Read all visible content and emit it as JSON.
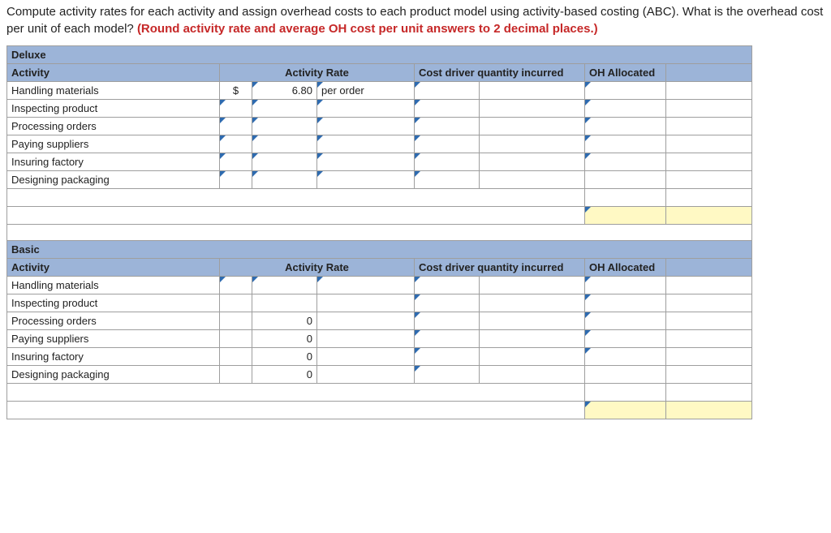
{
  "question": {
    "text1": "Compute activity rates for each activity and assign overhead costs to each product model using activity-based costing (ABC). What is the overhead cost per unit of each model? ",
    "red": "(Round activity rate and average OH cost per unit answers to 2 decimal places.)"
  },
  "headers": {
    "activity": "Activity",
    "activity_rate": "Activity Rate",
    "cost_driver": "Cost driver quantity incurred",
    "oh_allocated": "OH Allocated"
  },
  "sections": [
    {
      "title": "Deluxe",
      "rows": [
        {
          "activity": "Handling materials",
          "rate_sym": "$",
          "rate_val": "6.80",
          "rate_unit": "per order",
          "corner_r1": false,
          "corner_r2": true,
          "cdq_corner": true,
          "oh_corner": true
        },
        {
          "activity": "Inspecting product",
          "rate_sym": "",
          "rate_val": "",
          "rate_unit": "",
          "corner_r1": true,
          "corner_r2": true,
          "cdq_corner": true,
          "oh_corner": true
        },
        {
          "activity": "Processing orders",
          "rate_sym": "",
          "rate_val": "",
          "rate_unit": "",
          "corner_r1": true,
          "corner_r2": true,
          "cdq_corner": true,
          "oh_corner": true
        },
        {
          "activity": "Paying suppliers",
          "rate_sym": "",
          "rate_val": "",
          "rate_unit": "",
          "corner_r1": true,
          "corner_r2": true,
          "cdq_corner": true,
          "oh_corner": true
        },
        {
          "activity": "Insuring factory",
          "rate_sym": "",
          "rate_val": "",
          "rate_unit": "",
          "corner_r1": true,
          "corner_r2": true,
          "cdq_corner": true,
          "oh_corner": true
        },
        {
          "activity": "Designing packaging",
          "rate_sym": "",
          "rate_val": "",
          "rate_unit": "",
          "corner_r1": true,
          "corner_r2": true,
          "cdq_corner": true,
          "oh_corner": false
        }
      ],
      "footer_corner": true
    },
    {
      "title": "Basic",
      "rows": [
        {
          "activity": "Handling materials",
          "rate_sym": "",
          "rate_val": "",
          "rate_unit": "",
          "corner_r1": true,
          "corner_r2": true,
          "cdq_corner": true,
          "oh_corner": true
        },
        {
          "activity": "Inspecting product",
          "rate_sym": "",
          "rate_val": "",
          "rate_unit": "",
          "corner_r1": false,
          "corner_r2": false,
          "cdq_corner": true,
          "oh_corner": true
        },
        {
          "activity": "Processing orders",
          "rate_sym": "",
          "rate_val": "0",
          "rate_unit": "",
          "corner_r1": false,
          "corner_r2": false,
          "cdq_corner": true,
          "oh_corner": true
        },
        {
          "activity": "Paying suppliers",
          "rate_sym": "",
          "rate_val": "0",
          "rate_unit": "",
          "corner_r1": false,
          "corner_r2": false,
          "cdq_corner": true,
          "oh_corner": true
        },
        {
          "activity": "Insuring factory",
          "rate_sym": "",
          "rate_val": "0",
          "rate_unit": "",
          "corner_r1": false,
          "corner_r2": false,
          "cdq_corner": true,
          "oh_corner": true
        },
        {
          "activity": "Designing packaging",
          "rate_sym": "",
          "rate_val": "0",
          "rate_unit": "",
          "corner_r1": false,
          "corner_r2": false,
          "cdq_corner": true,
          "oh_corner": false
        }
      ],
      "footer_corner": true
    }
  ]
}
